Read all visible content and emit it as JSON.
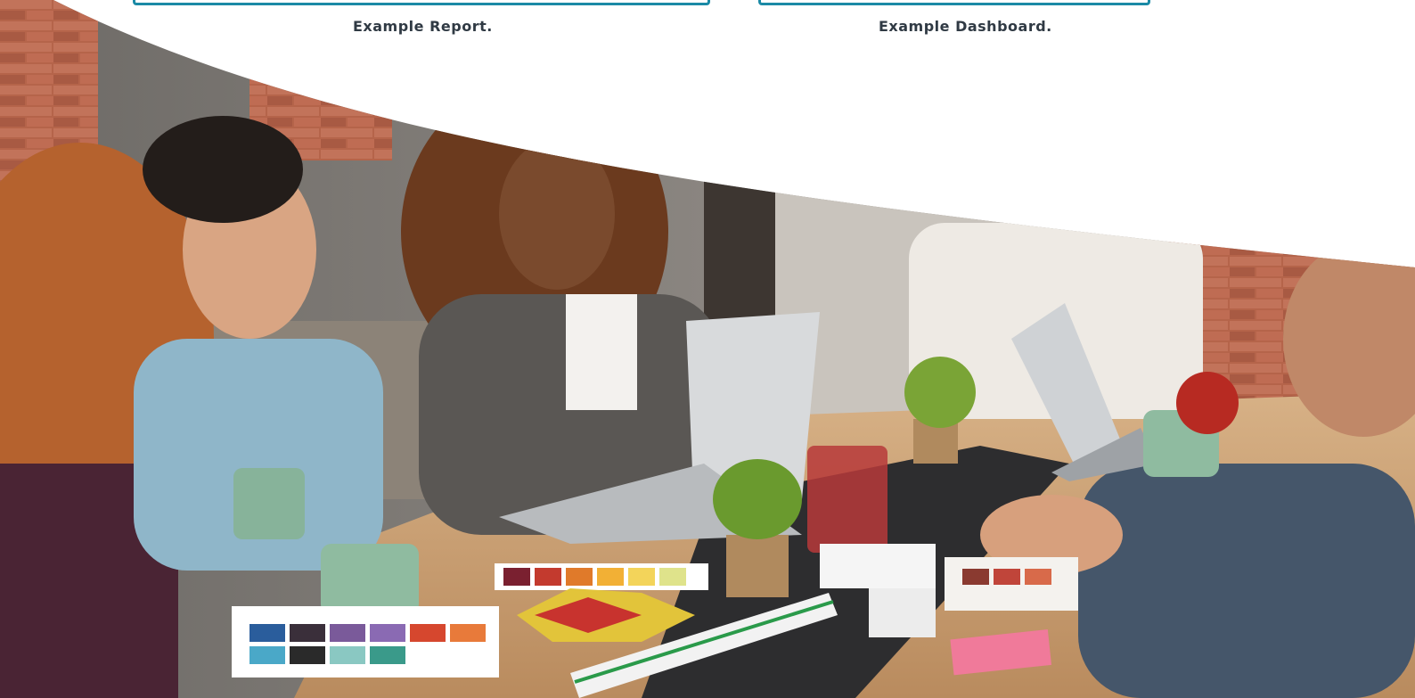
{
  "cards": [
    {
      "caption": "Example Report."
    },
    {
      "caption": "Example Dashboard."
    }
  ],
  "colors": {
    "frame_border": "#1b8aa6",
    "caption_text": "#303a44",
    "brick": "#b5644a",
    "table_wood": "#c99d6f"
  },
  "photo": {
    "alt": "Team collaborating at a table with laptops, coffee mugs and color swatches"
  }
}
